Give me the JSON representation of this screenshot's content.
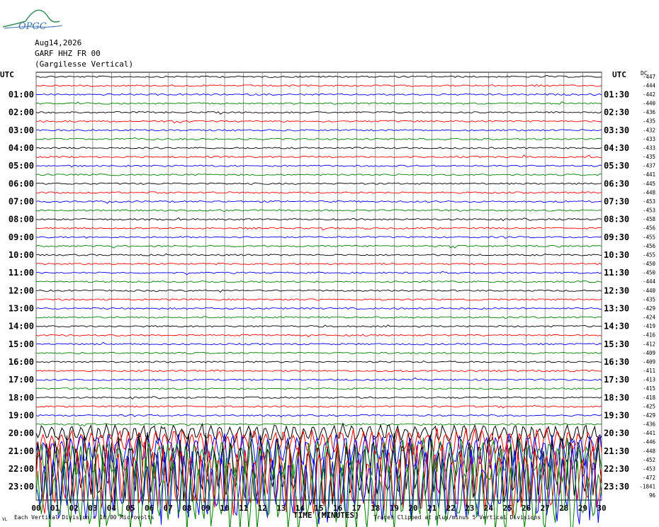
{
  "header": {
    "logo_text": "OPGC",
    "date": "Aug14,2026",
    "station": "GARF HHZ FR 00",
    "location": "(Gargilesse Vertical)"
  },
  "chart_data": {
    "type": "line",
    "title": "",
    "left_axis_label": "UTC",
    "right_axis_label": "UTC",
    "right_column_label": "DC",
    "xlabel": "TIME (MINUTES)",
    "xlim": [
      0,
      30
    ],
    "x_ticks": [
      "00",
      "01",
      "02",
      "03",
      "04",
      "05",
      "06",
      "07",
      "08",
      "09",
      "10",
      "11",
      "12",
      "13",
      "14",
      "15",
      "16",
      "17",
      "18",
      "19",
      "20",
      "21",
      "22",
      "23",
      "24",
      "25",
      "26",
      "27",
      "28",
      "29",
      "30"
    ],
    "left_hour_labels": [
      "01:00",
      "02:00",
      "03:00",
      "04:00",
      "05:00",
      "06:00",
      "07:00",
      "08:00",
      "09:00",
      "10:00",
      "11:00",
      "12:00",
      "13:00",
      "14:00",
      "15:00",
      "16:00",
      "17:00",
      "18:00",
      "19:00",
      "20:00",
      "21:00",
      "22:00",
      "23:00"
    ],
    "right_hour_labels": [
      "01:30",
      "02:30",
      "03:30",
      "04:30",
      "05:30",
      "06:30",
      "07:30",
      "08:30",
      "09:30",
      "10:30",
      "11:30",
      "12:30",
      "13:30",
      "14:30",
      "15:30",
      "16:30",
      "17:30",
      "18:30",
      "19:30",
      "20:30",
      "21:30",
      "22:30",
      "23:30"
    ],
    "dc_offsets": [
      "-447",
      "-444",
      "-442",
      "-440",
      "-436",
      "-435",
      "-432",
      "-433",
      "-433",
      "-435",
      "-437",
      "-441",
      "-445",
      "-448",
      "-453",
      "-453",
      "-458",
      "-456",
      "-455",
      "-456",
      "-455",
      "-450",
      "-450",
      "-444",
      "-440",
      "-435",
      "-429",
      "-424",
      "-419",
      "-416",
      "-412",
      "-409",
      "-409",
      "-411",
      "-413",
      "-415",
      "-418",
      "-425",
      "-429",
      "-436",
      "-441",
      "-446",
      "-448",
      "-452",
      "-453",
      "-472",
      "-1841",
      "96"
    ],
    "trace_count": 48,
    "trace_minutes": 30,
    "trace_colors": [
      "#000000",
      "#ff0000",
      "#0000ff",
      "#008000"
    ],
    "active_from_trace": 40,
    "grid": true,
    "footer_left": "Each Vertical Division = 10.00 Microvolts",
    "footer_right": "Traces Clipped at plus/minus 5 Vertical Divisions",
    "footer_mark": "VL"
  }
}
